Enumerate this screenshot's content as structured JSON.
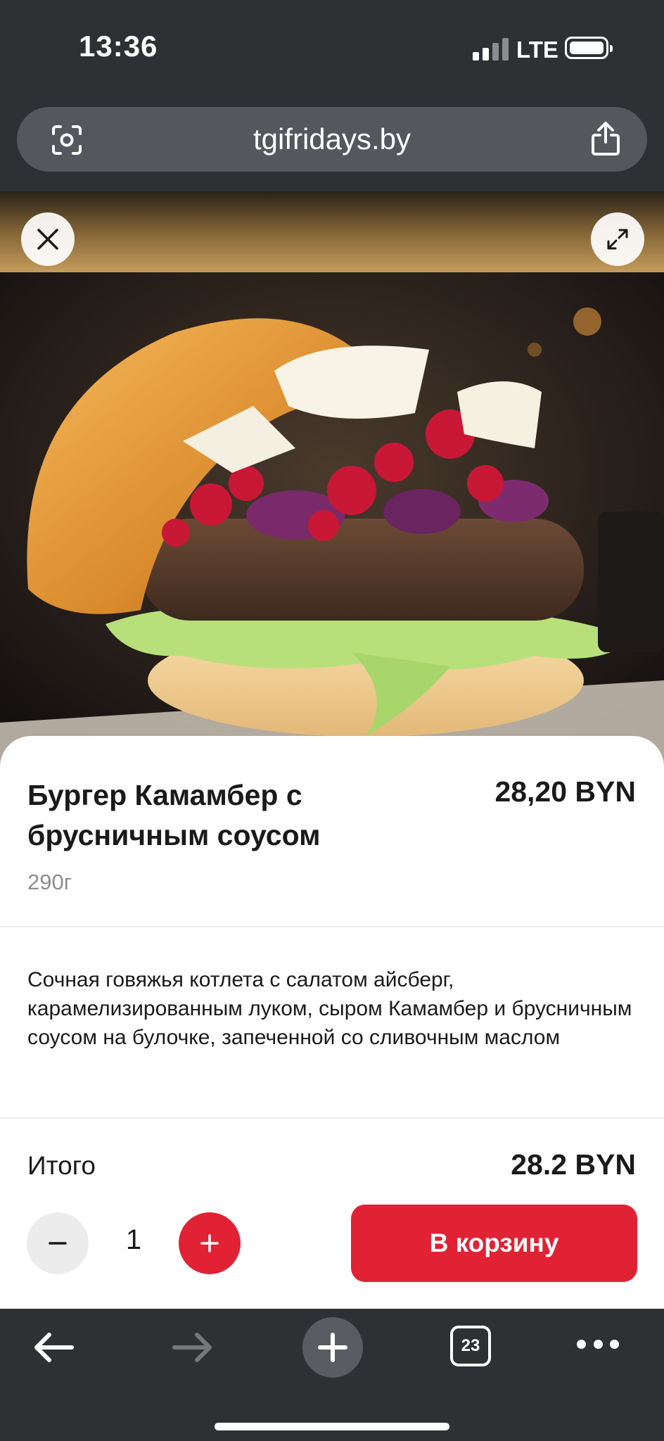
{
  "status_bar": {
    "time": "13:36",
    "network": "LTE",
    "signal_bars_active": 2,
    "signal_bars_total": 4
  },
  "browser": {
    "url": "tgifridays.by",
    "icons": {
      "left": "camera-scan-icon",
      "right": "share-icon"
    },
    "open_tabs": "23"
  },
  "product": {
    "title": "Бургер Камамбер с брусничным соусом",
    "price": "28,20 BYN",
    "weight": "290г",
    "description": "Сочная говяжья котлета с салатом айсберг, карамелизированным луком, сыром Камамбер и брусничным соусом на булочке, запеченной со сливочным маслом",
    "image_icons": {
      "close": "close-icon",
      "expand": "expand-icon"
    }
  },
  "order": {
    "total_label": "Итого",
    "total_value": "28.2 BYN",
    "quantity": "1",
    "add_to_cart_label": "В корзину"
  },
  "colors": {
    "accent": "#e12235",
    "browser_chrome": "#2e3034",
    "url_field": "#55575c",
    "muted_text": "#8e8e8e"
  }
}
